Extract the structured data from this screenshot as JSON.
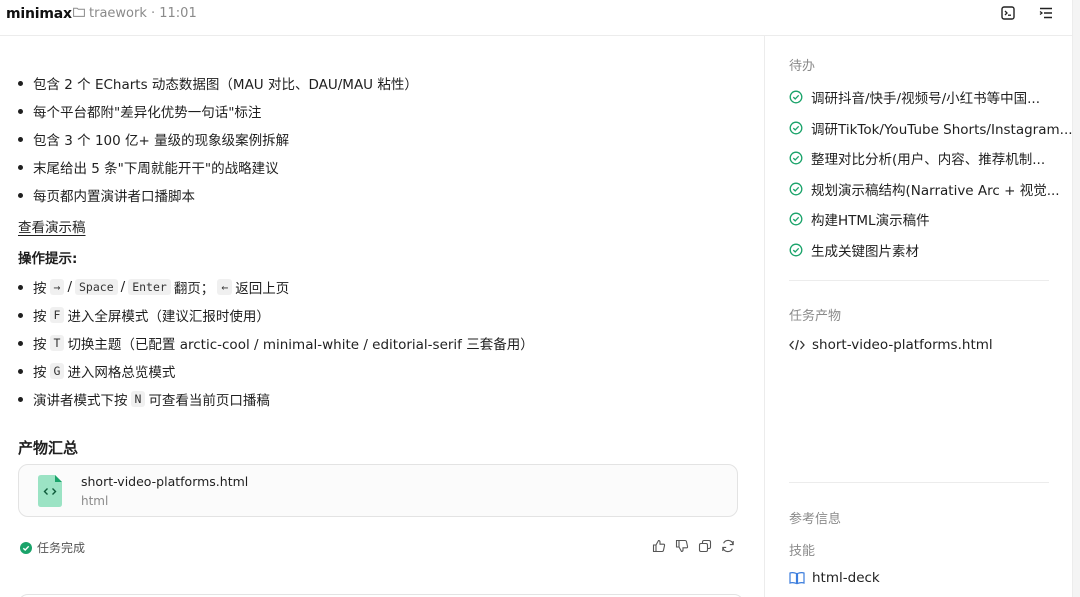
{
  "header": {
    "brand": "minimax",
    "project": "traework · 11:01"
  },
  "main": {
    "bullets_top": [
      "包含 2 个 ECharts 动态数据图（MAU 对比、DAU/MAU 粘性）",
      "每个平台都附\"差异化优势一句话\"标注",
      "包含 3 个 100 亿+ 量级的现象级案例拆解",
      "末尾给出 5 条\"下周就能开干\"的战略建议",
      "每页都内置演讲者口播脚本"
    ],
    "view_link": "查看演示稿",
    "tips_heading": "操作提示:",
    "tips": {
      "t1_pre": "按",
      "t1_k1": "→",
      "t1_s1": "/",
      "t1_k2": "Space",
      "t1_s2": "/",
      "t1_k3": "Enter",
      "t1_mid": "翻页；",
      "t1_k4": "←",
      "t1_post": "返回上页",
      "t2_pre": "按",
      "t2_k": "F",
      "t2_post": "进入全屏模式（建议汇报时使用）",
      "t3_pre": "按",
      "t3_k": "T",
      "t3_post": "切换主题（已配置 arctic-cool / minimal-white / editorial-serif 三套备用）",
      "t4_pre": "按",
      "t4_k": "G",
      "t4_post": "进入网格总览模式",
      "t5_pre": "演讲者模式下按",
      "t5_k": "N",
      "t5_post": "可查看当前页口播稿"
    },
    "outputs_title": "产物汇总",
    "file": {
      "name": "short-video-platforms.html",
      "type": "html"
    },
    "status": "任务完成"
  },
  "right_panel": {
    "todo_label": "待办",
    "todos": [
      "调研抖音/快手/视频号/小红书等中国...",
      "调研TikTok/YouTube Shorts/Instagram...",
      "整理对比分析(用户、内容、推荐机制...",
      "规划演示稿结构(Narrative Arc + 视觉...",
      "构建HTML演示稿件",
      "生成关键图片素材"
    ],
    "artifacts_label": "任务产物",
    "artifact": "short-video-platforms.html",
    "ref_label": "参考信息",
    "skills_label": "技能",
    "skill": "html-deck"
  },
  "colors": {
    "accent_green": "#1aa36a",
    "file_icon_bg": "#9be3c4",
    "skill_blue": "#3b7ddd"
  }
}
